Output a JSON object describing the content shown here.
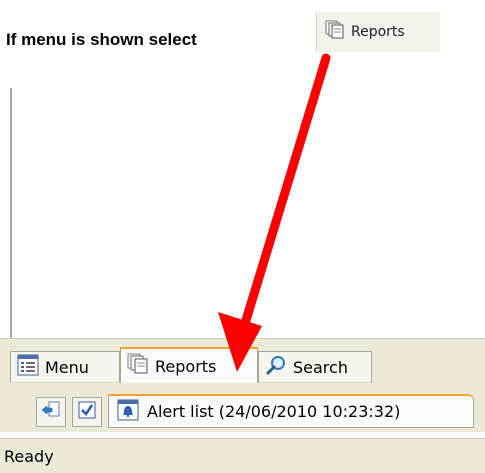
{
  "instruction": "If menu is shown select",
  "highlight_chip": {
    "label": "Reports",
    "icon": "reports-icon"
  },
  "tabs": [
    {
      "label": "Menu",
      "icon": "menu-icon",
      "active": false
    },
    {
      "label": "Reports",
      "icon": "reports-icon",
      "active": true
    },
    {
      "label": "Search",
      "icon": "search-icon",
      "active": false
    }
  ],
  "toolbar": {
    "buttons": [
      {
        "icon": "export-icon"
      },
      {
        "icon": "checkbox-icon"
      }
    ],
    "alert_tab": {
      "label": "Alert list (24/06/2010 10:23:32)",
      "icon": "alert-icon"
    }
  },
  "status": {
    "text": "Ready"
  },
  "colors": {
    "arrow": "#ff0000",
    "active_tab_accent": "#f0a52f",
    "chrome": "#ece9d8"
  }
}
